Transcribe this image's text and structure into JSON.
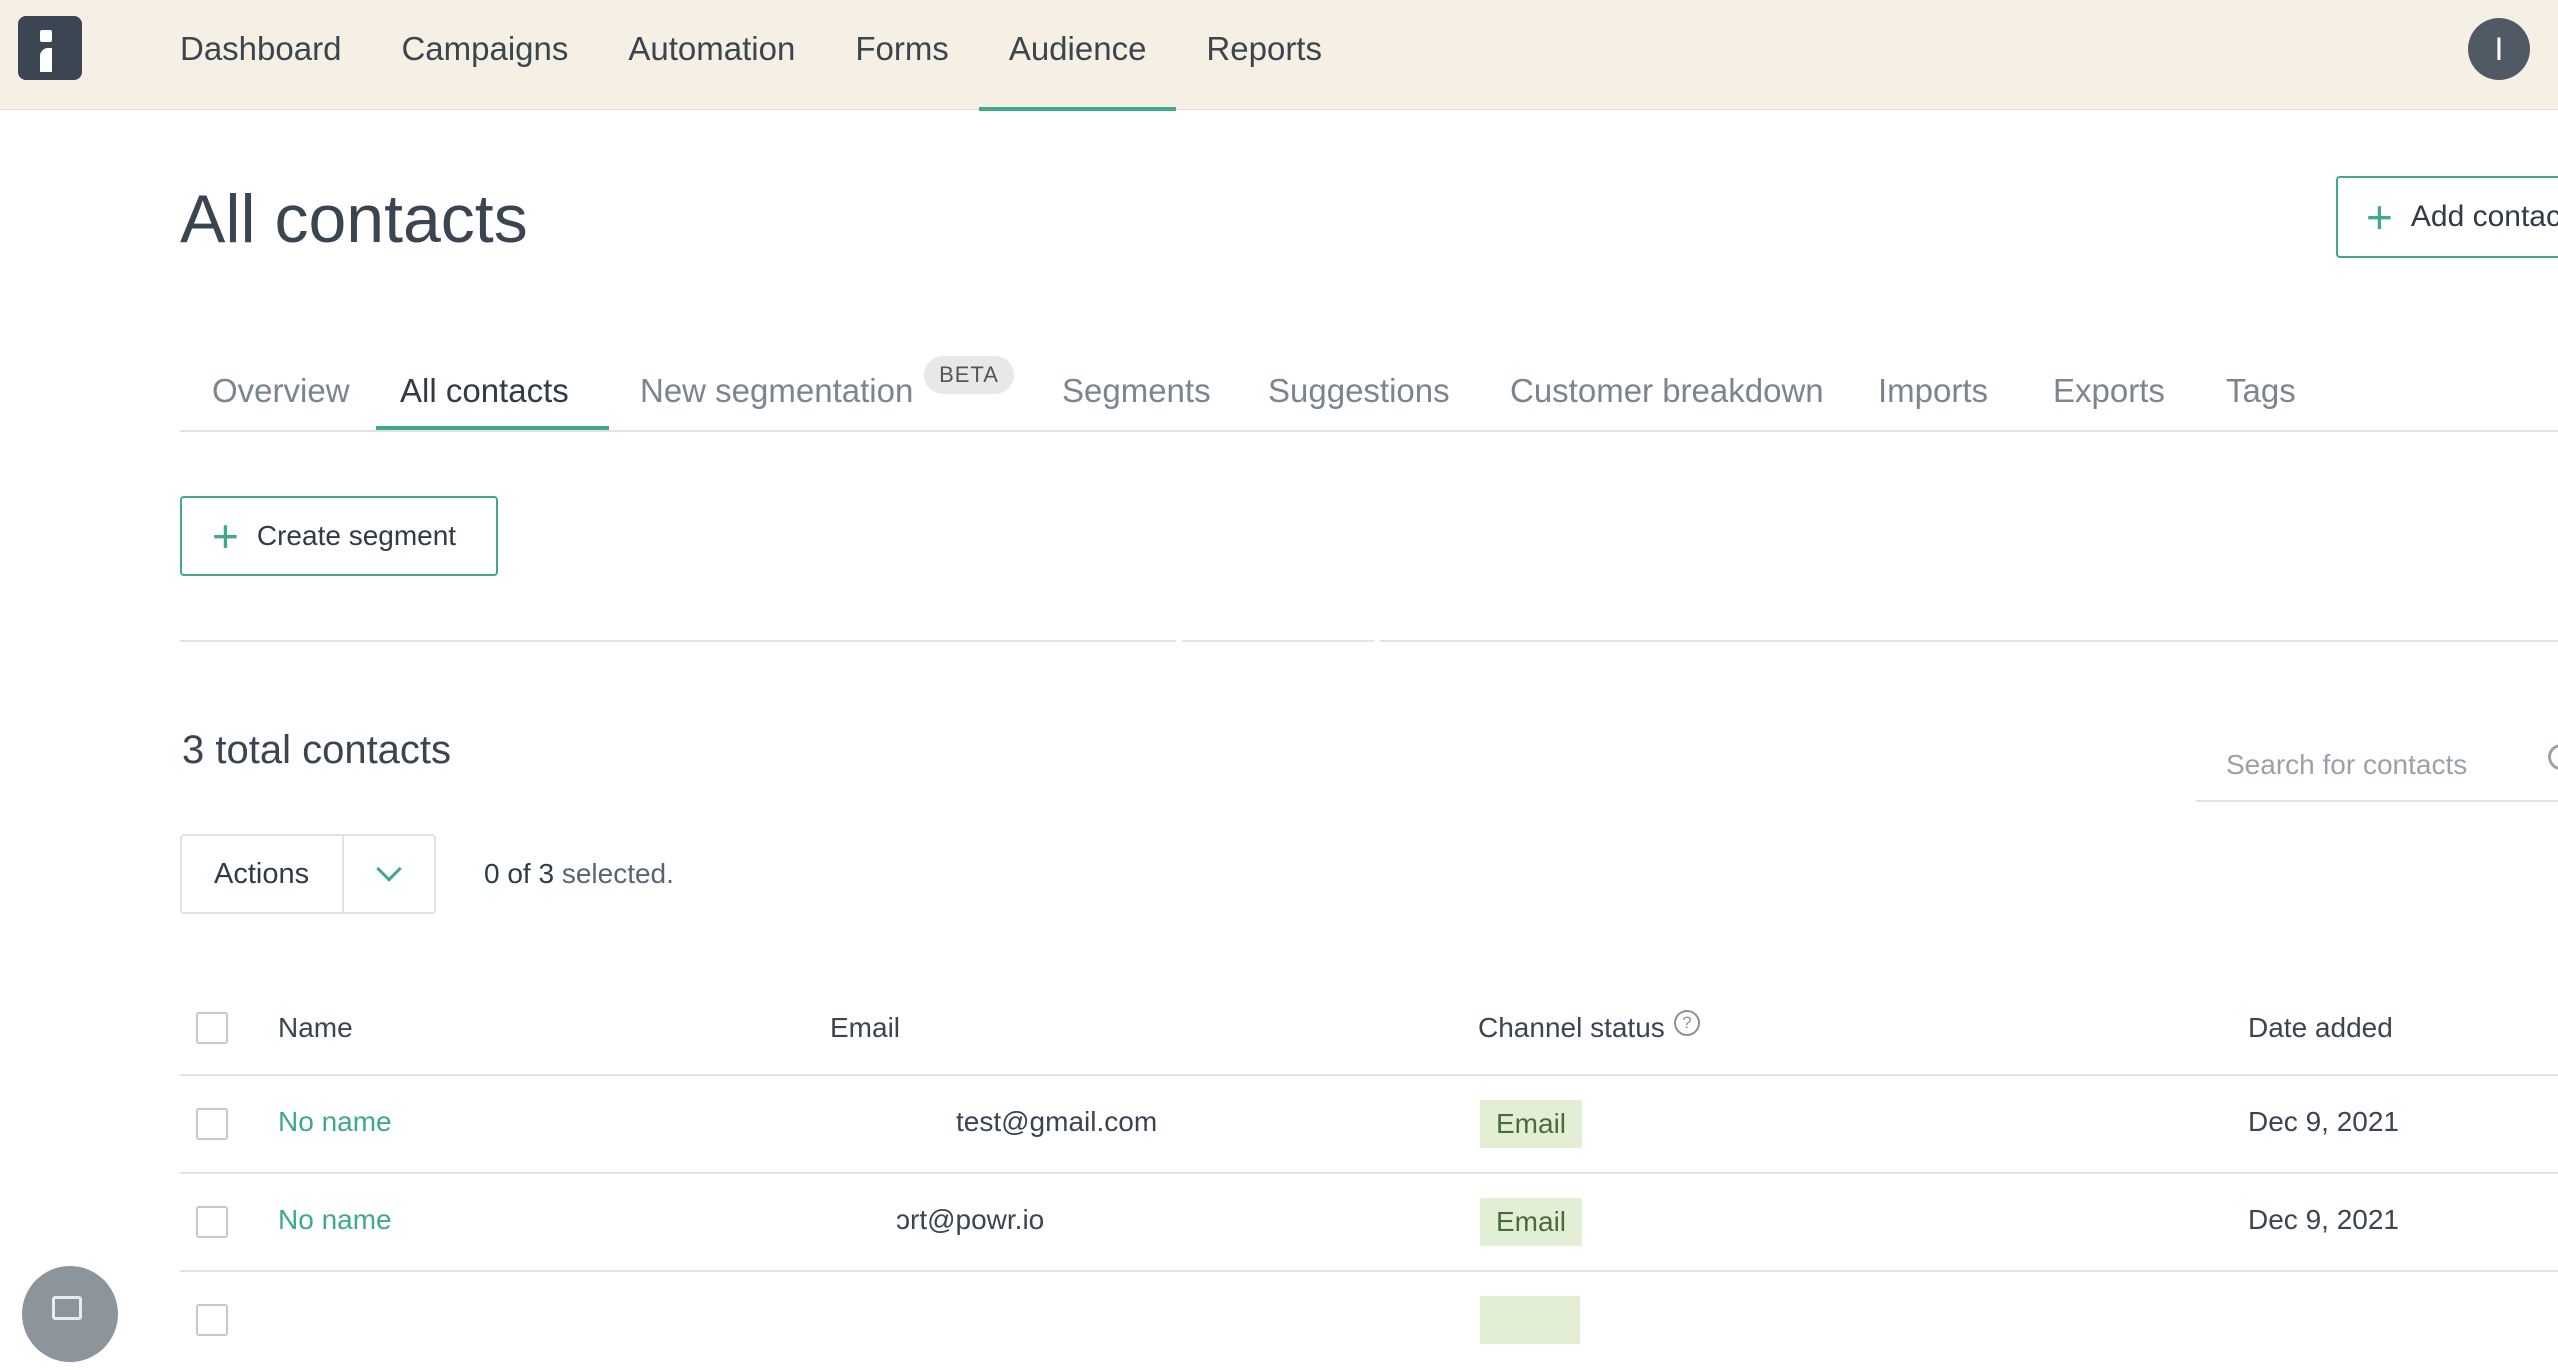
{
  "nav": {
    "items": [
      "Dashboard",
      "Campaigns",
      "Automation",
      "Forms",
      "Audience",
      "Reports"
    ],
    "active": "Audience",
    "avatar_initial": "I"
  },
  "page": {
    "title": "All contacts",
    "add_button": "Add contac"
  },
  "tabs": {
    "items": [
      "Overview",
      "All contacts",
      "New segmentation",
      "Segments",
      "Suggestions",
      "Customer breakdown",
      "Imports",
      "Exports",
      "Tags"
    ],
    "beta_badge": "BETA",
    "active": "All contacts"
  },
  "segment": {
    "create_label": "Create segment"
  },
  "contacts": {
    "total": "3 total contacts",
    "search_placeholder": "Search for contacts",
    "actions_label": "Actions",
    "selected_count": "0 of 3",
    "selected_suffix": " selected."
  },
  "table": {
    "headers": {
      "name": "Name",
      "email": "Email",
      "channel_status": "Channel status",
      "date_added": "Date added"
    },
    "help_glyph": "?",
    "rows": [
      {
        "name": "No name",
        "email": "test@gmail.com",
        "channel": "Email",
        "date": "Dec 9, 2021"
      },
      {
        "name": "No name",
        "email": "ɔrt@powr.io",
        "channel": "Email",
        "date": "Dec 9, 2021"
      },
      {
        "name": "",
        "email": "",
        "channel": "",
        "date": ""
      }
    ]
  },
  "colors": {
    "accent": "#3fa88f",
    "nav_bg": "#f6f0e4",
    "badge_bg": "#e2efd4"
  }
}
